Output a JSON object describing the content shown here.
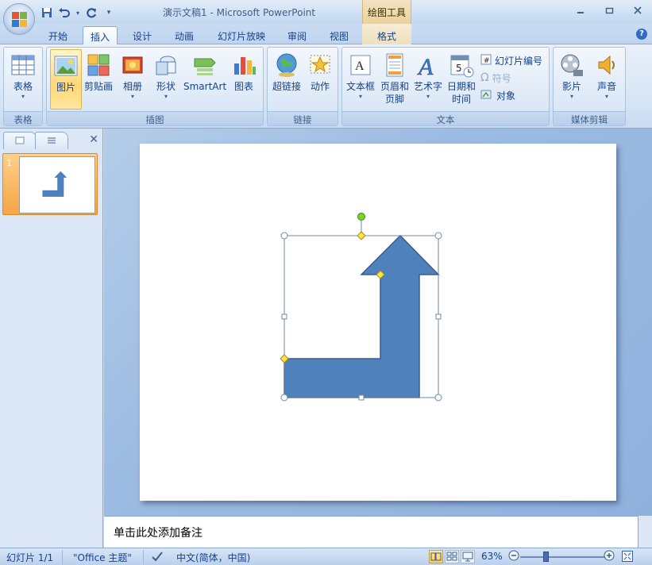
{
  "titlebar": {
    "document_title": "演示文稿1 - Microsoft PowerPoint",
    "context_tools_label": "绘图工具"
  },
  "quick_access": {
    "icons": [
      "save-icon",
      "undo-icon",
      "redo-icon",
      "customize-icon"
    ]
  },
  "tabs": [
    {
      "label": "开始",
      "active": false
    },
    {
      "label": "插入",
      "active": true
    },
    {
      "label": "设计",
      "active": false
    },
    {
      "label": "动画",
      "active": false
    },
    {
      "label": "幻灯片放映",
      "active": false
    },
    {
      "label": "审阅",
      "active": false
    },
    {
      "label": "视图",
      "active": false
    },
    {
      "label": "格式",
      "active": false,
      "context": true
    }
  ],
  "ribbon": {
    "groups": {
      "tables": {
        "label": "表格",
        "buttons": [
          {
            "label": "表格"
          }
        ]
      },
      "illustrations": {
        "label": "插图",
        "buttons": [
          {
            "label": "图片",
            "selected": true
          },
          {
            "label": "剪贴画"
          },
          {
            "label": "相册"
          },
          {
            "label": "形状"
          },
          {
            "label": "SmartArt"
          },
          {
            "label": "图表"
          }
        ]
      },
      "links": {
        "label": "链接",
        "buttons": [
          {
            "label": "超链接"
          },
          {
            "label": "动作"
          }
        ]
      },
      "text": {
        "label": "文本",
        "buttons": [
          {
            "label": "文本框"
          },
          {
            "label": "页眉和",
            "label2": "页脚"
          },
          {
            "label": "艺术字"
          },
          {
            "label": "日期和",
            "label2": "时间"
          }
        ],
        "small_buttons": [
          {
            "label": "幻灯片编号",
            "disabled": false
          },
          {
            "label": "符号",
            "disabled": true
          },
          {
            "label": "对象",
            "disabled": false
          }
        ]
      },
      "media": {
        "label": "媒体剪辑",
        "buttons": [
          {
            "label": "影片"
          },
          {
            "label": "声音"
          }
        ]
      }
    }
  },
  "slides_panel": {
    "slide_number": "1"
  },
  "notes": {
    "placeholder": "单击此处添加备注"
  },
  "status": {
    "slide_counter": "幻灯片 1/1",
    "theme": "\"Office 主题\"",
    "language": "中文(简体，中国)",
    "zoom": "63%"
  },
  "colors": {
    "shape_fill": "#4f81bd",
    "shape_stroke": "#385d8a",
    "accent": "#15428b"
  }
}
